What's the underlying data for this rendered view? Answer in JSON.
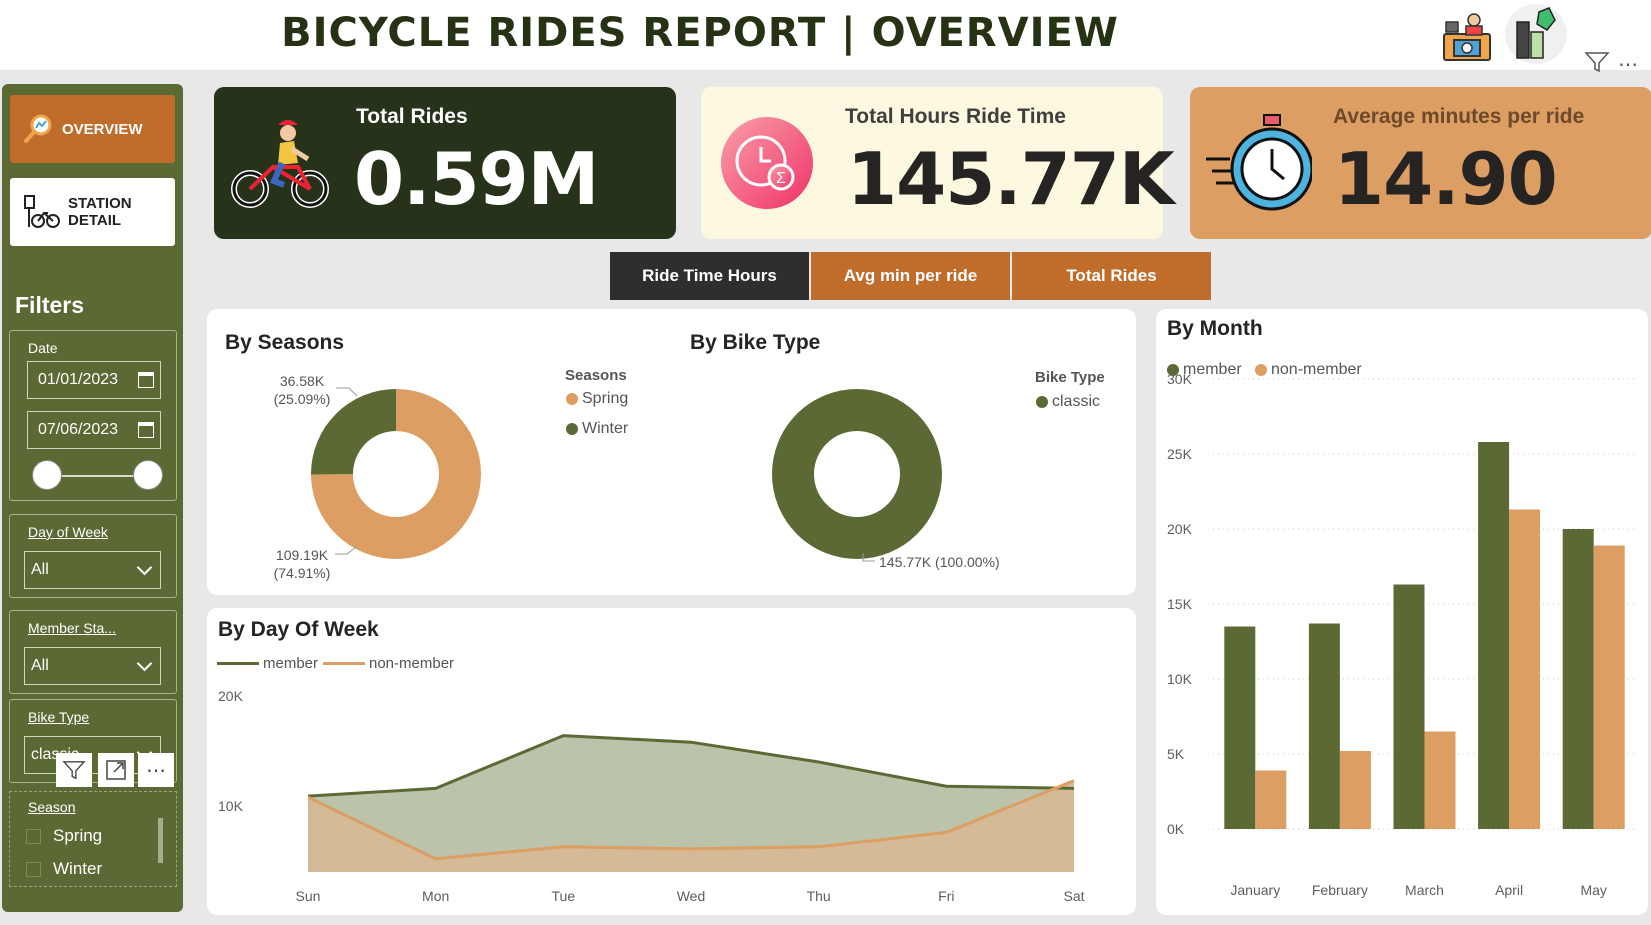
{
  "header": {
    "title": "BICYCLE RIDES REPORT | OVERVIEW"
  },
  "nav": {
    "overview_label": "OVERVIEW",
    "station_label_1": "STATION",
    "station_label_2": "DETAIL"
  },
  "filters": {
    "heading": "Filters",
    "date": {
      "label": "Date",
      "start": "01/01/2023",
      "end": "07/06/2023"
    },
    "day_of_week": {
      "label": "Day of Week",
      "value": "All"
    },
    "member_status": {
      "label": "Member Sta...",
      "value": "All"
    },
    "bike_type": {
      "label": "Bike Type",
      "value": "classic"
    },
    "season": {
      "label": "Season",
      "options": [
        "Spring",
        "Winter"
      ]
    }
  },
  "kpis": [
    {
      "label": "Total Rides",
      "value": "0.59M"
    },
    {
      "label": "Total Hours Ride Time",
      "value": "145.77K"
    },
    {
      "label": "Average minutes per ride",
      "value": "14.90"
    }
  ],
  "tabs": [
    "Ride Time Hours",
    "Avg min per ride",
    "Total Rides"
  ],
  "colors": {
    "member": "#5b6a35",
    "non_member": "#dc9e62",
    "accent": "#c06c2b",
    "dark": "#26321a"
  },
  "chart_data": [
    {
      "type": "pie",
      "title": "By Seasons",
      "legend_title": "Seasons",
      "labels": [
        "Spring",
        "Winter"
      ],
      "values": [
        109.19,
        36.58
      ],
      "value_labels": [
        "109.19K",
        "36.58K"
      ],
      "pct_labels": [
        "(74.91%)",
        "(25.09%)"
      ]
    },
    {
      "type": "pie",
      "title": "By Bike Type",
      "legend_title": "Bike Type",
      "labels": [
        "classic"
      ],
      "values": [
        145.77
      ],
      "value_labels": [
        "145.77K (100.00%)"
      ]
    },
    {
      "type": "area",
      "title": "By Day Of Week",
      "categories": [
        "Sun",
        "Mon",
        "Tue",
        "Wed",
        "Thu",
        "Fri",
        "Sat"
      ],
      "series": [
        {
          "name": "member",
          "values": [
            10.9,
            11.6,
            16.4,
            15.8,
            14.0,
            11.8,
            11.6
          ]
        },
        {
          "name": "non-member",
          "values": [
            10.8,
            5.2,
            6.3,
            6.1,
            6.3,
            7.6,
            12.3
          ]
        }
      ],
      "y_ticks": [
        "20K",
        "10K"
      ],
      "ylim": [
        4,
        20
      ]
    },
    {
      "type": "bar",
      "title": "By Month",
      "categories": [
        "January",
        "February",
        "March",
        "April",
        "May"
      ],
      "series": [
        {
          "name": "member",
          "values": [
            13.5,
            13.7,
            16.3,
            25.8,
            20.0
          ]
        },
        {
          "name": "non-member",
          "values": [
            3.9,
            5.2,
            6.5,
            21.3,
            18.9
          ]
        }
      ],
      "y_ticks": [
        "0K",
        "5K",
        "10K",
        "15K",
        "20K",
        "25K",
        "30K"
      ],
      "ylim": [
        0,
        30
      ]
    }
  ]
}
